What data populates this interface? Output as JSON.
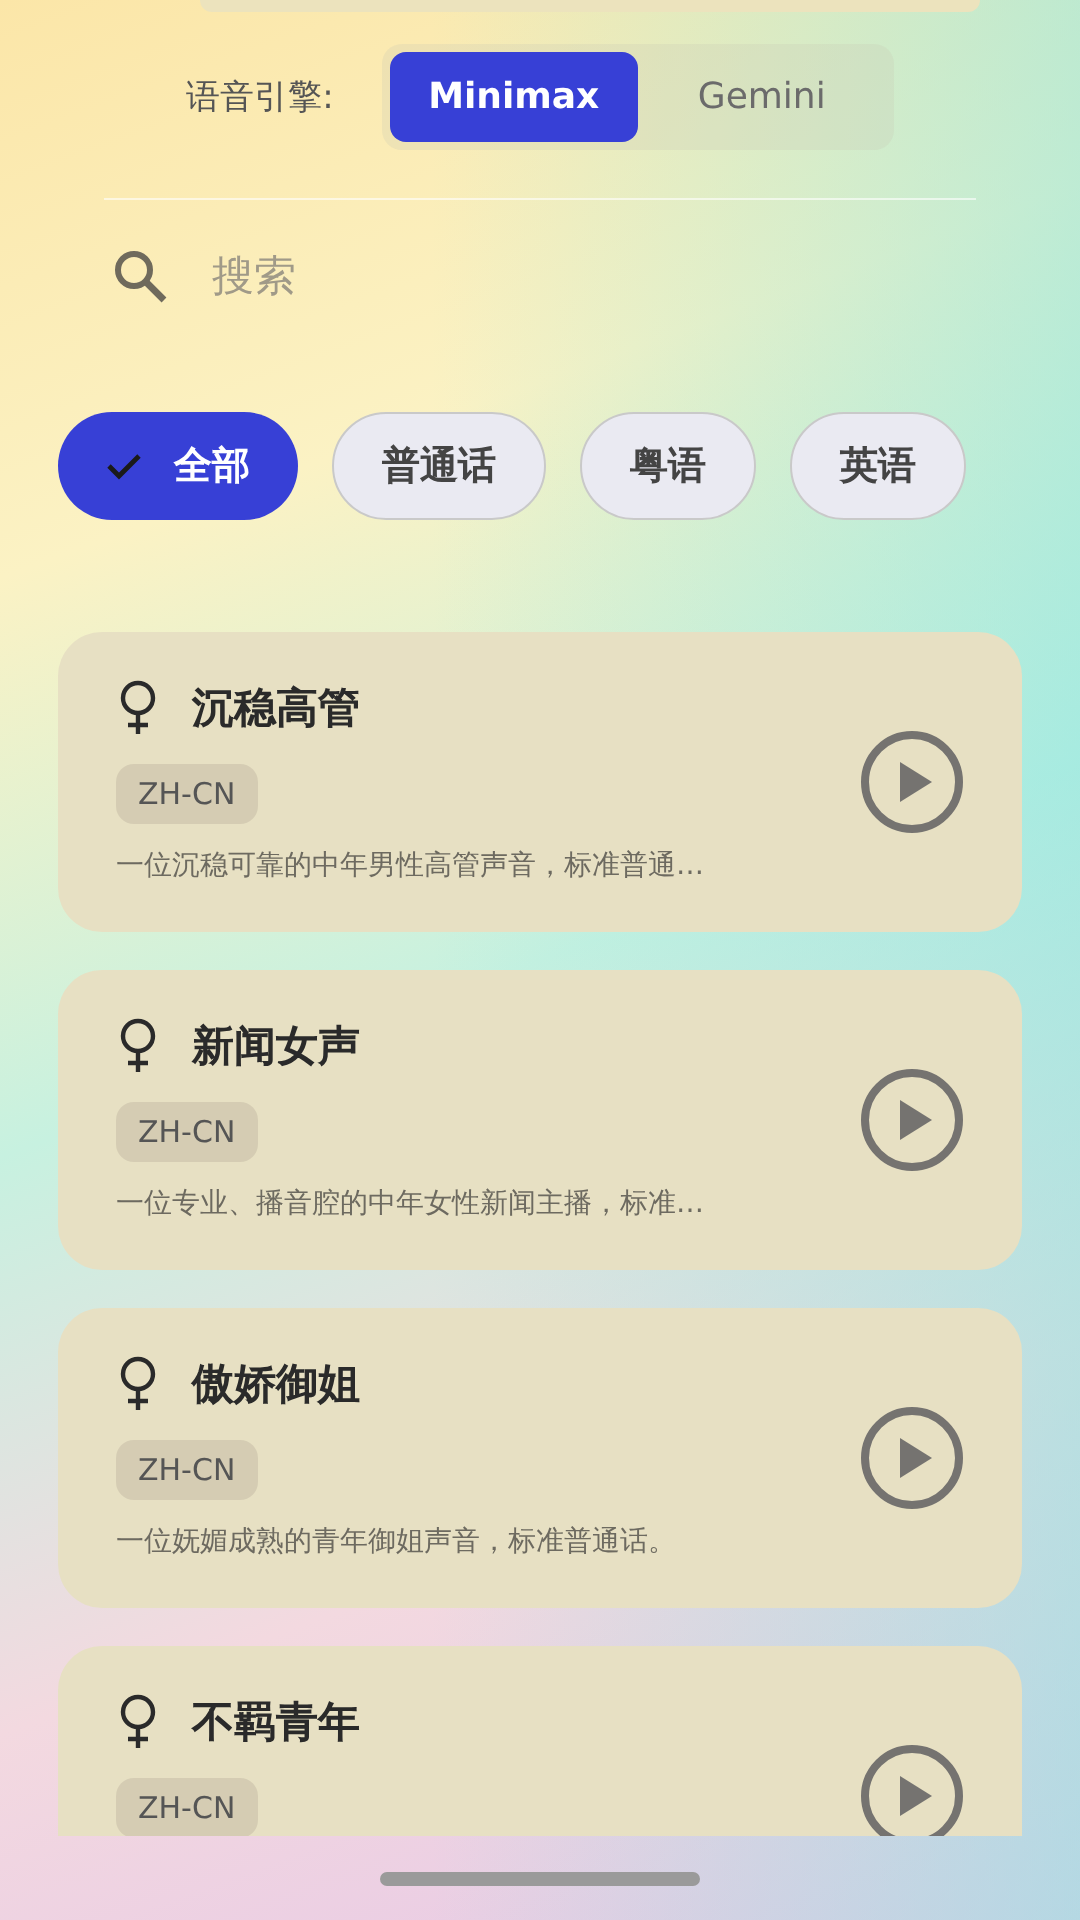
{
  "engine": {
    "label": "语音引擎:",
    "options": [
      {
        "label": "Minimax",
        "selected": true
      },
      {
        "label": "Gemini",
        "selected": false
      }
    ]
  },
  "search": {
    "placeholder": "搜索"
  },
  "filters": [
    {
      "label": "全部",
      "selected": true
    },
    {
      "label": "普通话",
      "selected": false
    },
    {
      "label": "粤语",
      "selected": false
    },
    {
      "label": "英语",
      "selected": false
    }
  ],
  "voices": [
    {
      "name": "沉稳高管",
      "tag": "ZH-CN",
      "description": "一位沉稳可靠的中年男性高管声音，标准普通…"
    },
    {
      "name": "新闻女声",
      "tag": "ZH-CN",
      "description": "一位专业、播音腔的中年女性新闻主播，标准…"
    },
    {
      "name": "傲娇御姐",
      "tag": "ZH-CN",
      "description": "一位妩媚成熟的青年御姐声音，标准普通话。"
    },
    {
      "name": "不羁青年",
      "tag": "ZH-CN"
    }
  ]
}
